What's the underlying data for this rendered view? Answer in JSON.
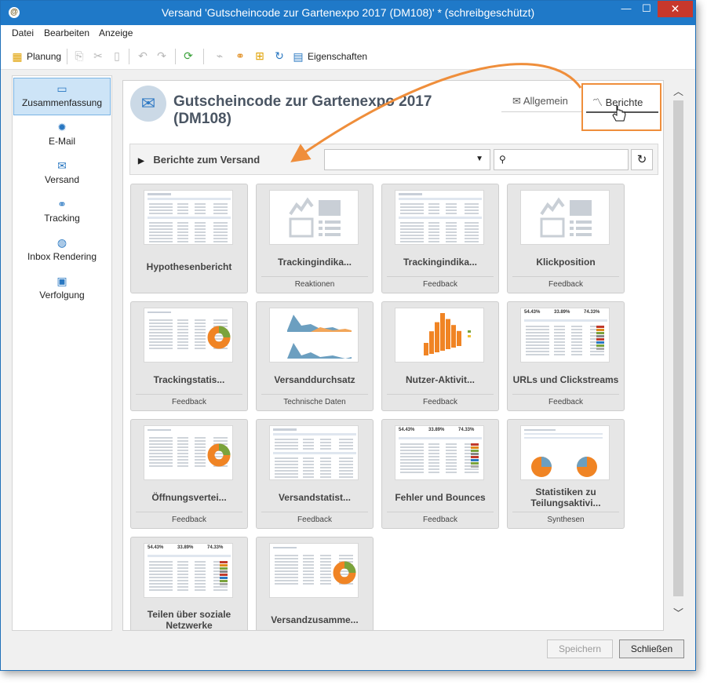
{
  "window": {
    "title": "Versand 'Gutscheincode zur Gartenexpo 2017 (DM108)' * (schreibgeschützt)",
    "close_glyph": "✕"
  },
  "menu": [
    "Datei",
    "Bearbeiten",
    "Anzeige"
  ],
  "toolbar": {
    "planning": "Planung",
    "properties": "Eigenschaften"
  },
  "sidebar": [
    {
      "label": "Zusammenfassung",
      "icon": "summary-icon",
      "selected": true
    },
    {
      "label": "E-Mail",
      "icon": "email-icon"
    },
    {
      "label": "Versand",
      "icon": "delivery-icon"
    },
    {
      "label": "Tracking",
      "icon": "tracking-icon"
    },
    {
      "label": "Inbox Rendering",
      "icon": "inbox-rendering-icon"
    },
    {
      "label": "Verfolgung",
      "icon": "audit-icon"
    }
  ],
  "header": {
    "title": "Gutscheincode zur Gartenexpo 2017 (DM108)",
    "tabs": {
      "general": "Allgemein",
      "reports": "Berichte"
    }
  },
  "filter": {
    "label": "Berichte zum Versand",
    "category_value": "",
    "search_value": ""
  },
  "reports": [
    {
      "title": "Hypothesenbericht",
      "tag": "",
      "thumb": "table"
    },
    {
      "title": "Trackingindika...",
      "tag": "Reaktionen",
      "thumb": "placeholder"
    },
    {
      "title": "Trackingindika...",
      "tag": "Feedback",
      "thumb": "table"
    },
    {
      "title": "Klickposition",
      "tag": "Feedback",
      "thumb": "placeholder"
    },
    {
      "title": "Trackingstatis...",
      "tag": "Feedback",
      "thumb": "donut"
    },
    {
      "title": "Versanddurchsatz",
      "tag": "Technische Daten",
      "thumb": "area"
    },
    {
      "title": "Nutzer-Aktivit...",
      "tag": "Feedback",
      "thumb": "bars3d"
    },
    {
      "title": "URLs und Clickstreams",
      "tag": "Feedback",
      "thumb": "stats"
    },
    {
      "title": "Öffnungsvertei...",
      "tag": "Feedback",
      "thumb": "donut"
    },
    {
      "title": "Versandstatist...",
      "tag": "Feedback",
      "thumb": "table"
    },
    {
      "title": "Fehler und Bounces",
      "tag": "Feedback",
      "thumb": "stats"
    },
    {
      "title": "Statistiken zu Teilungsaktivi...",
      "tag": "Synthesen",
      "thumb": "pies"
    },
    {
      "title": "Teilen über soziale Netzwerke",
      "tag": "",
      "thumb": "stats"
    },
    {
      "title": "Versandzusamme...",
      "tag": "",
      "thumb": "donut"
    }
  ],
  "thumb_stats": [
    "54.43%",
    "33.89%",
    "74.33%"
  ],
  "buttons": {
    "save": "Speichern",
    "close": "Schließen"
  },
  "colors": {
    "accent": "#1f79c8",
    "annotation": "#ef8e3b",
    "donut_orange": "#f08424",
    "donut_green": "#7aa33c",
    "area_blue": "#6c9fc0"
  }
}
